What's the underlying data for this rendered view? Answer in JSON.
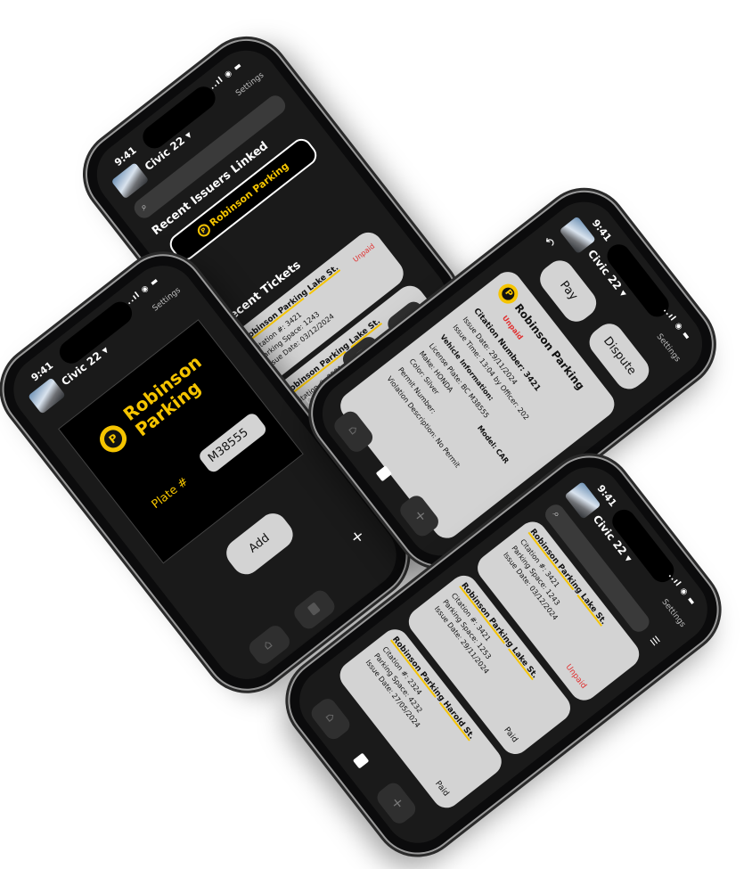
{
  "status": {
    "time": "9:41",
    "signal": "..ıl ◉ ▬"
  },
  "vehicle": {
    "name": "Civic 22 ▾"
  },
  "nav": {
    "settings": "Settings"
  },
  "home": {
    "search_placeholder": "",
    "recent_issuers_title": "Recent Issuers Linked",
    "issuer_name": "Robinson Parking",
    "recent_tickets_title": "Recent Tickets",
    "tickets": [
      {
        "title": "Robinson Parking Lake St.",
        "citation": "Citation #: 3421",
        "space": "Parking Space: 1243",
        "date": "Issue Date: 03/12/2024",
        "status": "Unpaid"
      },
      {
        "title": "Robinson Parking Lake St.",
        "citation": "Citation #: 3521",
        "space": "Parking Space: 1253",
        "date": "",
        "status": ""
      }
    ]
  },
  "add_issuer": {
    "brand_line1": "Robinson",
    "brand_line2": "Parking",
    "plate_label": "Plate #",
    "plate_value": "M38555",
    "add_button": "Add"
  },
  "detail": {
    "pay_button": "Pay",
    "dispute_button": "Dispute",
    "issuer_name": "Robinson Parking",
    "status": "Unpaid",
    "citation_number": "Citation Number: 3421",
    "issue_date": "Issue Date: 29/11/2024",
    "issue_time": "Issue Time: 13:04 by Officer: 202",
    "vehicle_info": "Vehicle Information:",
    "license_plate": "License Plate: BC M38555",
    "make": "Make: HONDA",
    "model": "Model: CAR",
    "color": "Color: Silver",
    "permit_number": "Permit Number:",
    "violation": "Violation Description: No Permit"
  },
  "list": {
    "tickets": [
      {
        "title": "Robinson Parking Lake St.",
        "citation": "Citation #: 3421",
        "space": "Parking Space: 1243",
        "date": "Issue Date: 03/12/2024",
        "status": "Unpaid"
      },
      {
        "title": "Robinson Parking Lake St.",
        "citation": "Citation #: 3421",
        "space": "Parking Space: 1253",
        "date": "Issue Date: 29/11/2024",
        "status": "Paid"
      },
      {
        "title": "Robinson Parking Harold St.",
        "citation": "Citation #: 2324",
        "space": "Parking Space: 4232",
        "date": "Issue Date: 27/05/2024",
        "status": "Paid"
      }
    ]
  },
  "icons": {
    "home": "home-icon",
    "tickets": "tickets-icon",
    "add": "plus-icon",
    "back": "back-arrow-icon",
    "search": "search-icon"
  },
  "colors": {
    "accent": "#f5c400",
    "unpaid": "#e03131",
    "card": "#d3d3d3",
    "screen": "#1a1a1a"
  }
}
